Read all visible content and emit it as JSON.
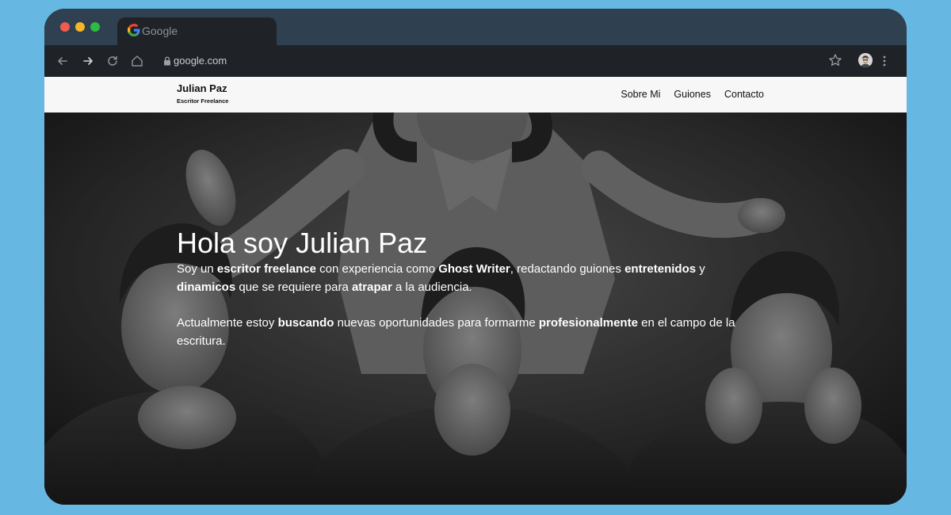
{
  "browser": {
    "tab_title": "Google",
    "url": "google.com"
  },
  "site": {
    "brand_name": "Julian Paz",
    "brand_subtitle": "Escritor Freelance",
    "nav": [
      "Sobre Mi",
      "Guiones",
      "Contacto"
    ]
  },
  "hero": {
    "title": "Hola soy Julian Paz",
    "p1": [
      {
        "t": "Soy un ",
        "b": false
      },
      {
        "t": "escritor freelance",
        "b": true
      },
      {
        "t": " con experiencia como ",
        "b": false
      },
      {
        "t": "Ghost Writer",
        "b": true
      },
      {
        "t": ", redactando guiones ",
        "b": false
      },
      {
        "t": "entretenidos",
        "b": true
      },
      {
        "t": " y ",
        "b": false
      },
      {
        "t": "dinamicos",
        "b": true
      },
      {
        "t": " que se requiere para ",
        "b": false
      },
      {
        "t": "atrapar",
        "b": true
      },
      {
        "t": " a la audiencia.",
        "b": false
      }
    ],
    "p2": [
      {
        "t": "Actualmente estoy ",
        "b": false
      },
      {
        "t": "buscando",
        "b": true
      },
      {
        "t": " nuevas oportunidades para formarme ",
        "b": false
      },
      {
        "t": "profesionalmente",
        "b": true
      },
      {
        "t": " en el campo de la escritura.",
        "b": false
      }
    ]
  },
  "colors": {
    "page_background": "#66b7e2",
    "browser_frame": "#2f4050",
    "toolbar": "#1f2327",
    "site_header": "#f7f7f7",
    "hero_text": "#ffffff"
  },
  "icons": [
    "google-logo-icon",
    "back-arrow-icon",
    "forward-arrow-icon",
    "reload-icon",
    "home-icon",
    "lock-icon",
    "star-icon",
    "avatar",
    "menu-dots-icon"
  ]
}
